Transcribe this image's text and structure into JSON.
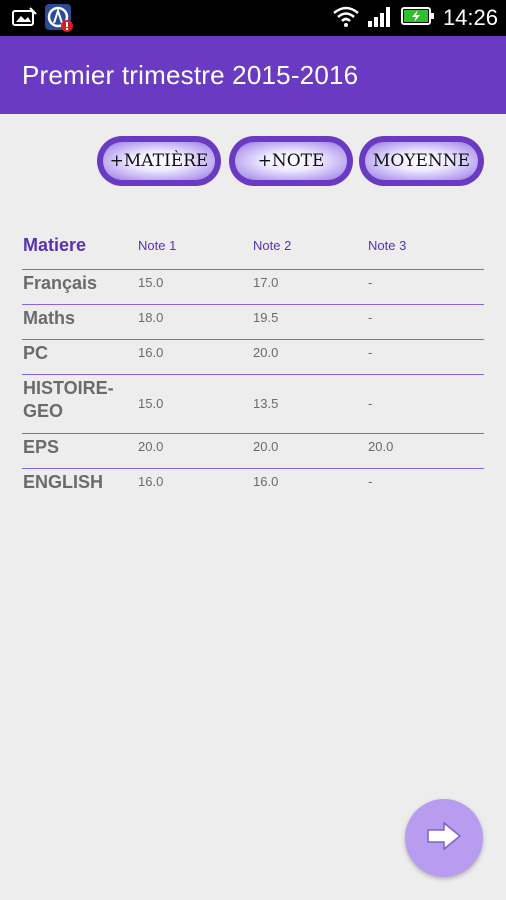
{
  "status_bar": {
    "time": "14:26",
    "icons": [
      "photo-notification-icon",
      "app-alert-icon",
      "wifi-icon",
      "signal-icon",
      "battery-charging-icon"
    ]
  },
  "app_bar": {
    "title": "Premier trimestre 2015-2016",
    "color": "#6a3bc2"
  },
  "actions": {
    "add_subject": "+MATIÈRE",
    "add_grade": "+NOTE",
    "average": "MOYENNE"
  },
  "table": {
    "headers": [
      "Matiere",
      "Note 1",
      "Note 2",
      "Note 3"
    ],
    "rows": [
      {
        "subject": "Français",
        "grades": [
          "15.0",
          "17.0",
          "-"
        ]
      },
      {
        "subject": "Maths",
        "grades": [
          "18.0",
          "19.5",
          "-"
        ]
      },
      {
        "subject": "PC",
        "grades": [
          "16.0",
          "20.0",
          "-"
        ]
      },
      {
        "subject": "HISTOIRE-GEO",
        "grades": [
          "15.0",
          "13.5",
          "-"
        ]
      },
      {
        "subject": "EPS",
        "grades": [
          "20.0",
          "20.0",
          "20.0"
        ]
      },
      {
        "subject": "ENGLISH",
        "grades": [
          "16.0",
          "16.0",
          "-"
        ]
      }
    ]
  },
  "fab": {
    "icon": "arrow-right-icon",
    "color": "#b79cf0"
  }
}
